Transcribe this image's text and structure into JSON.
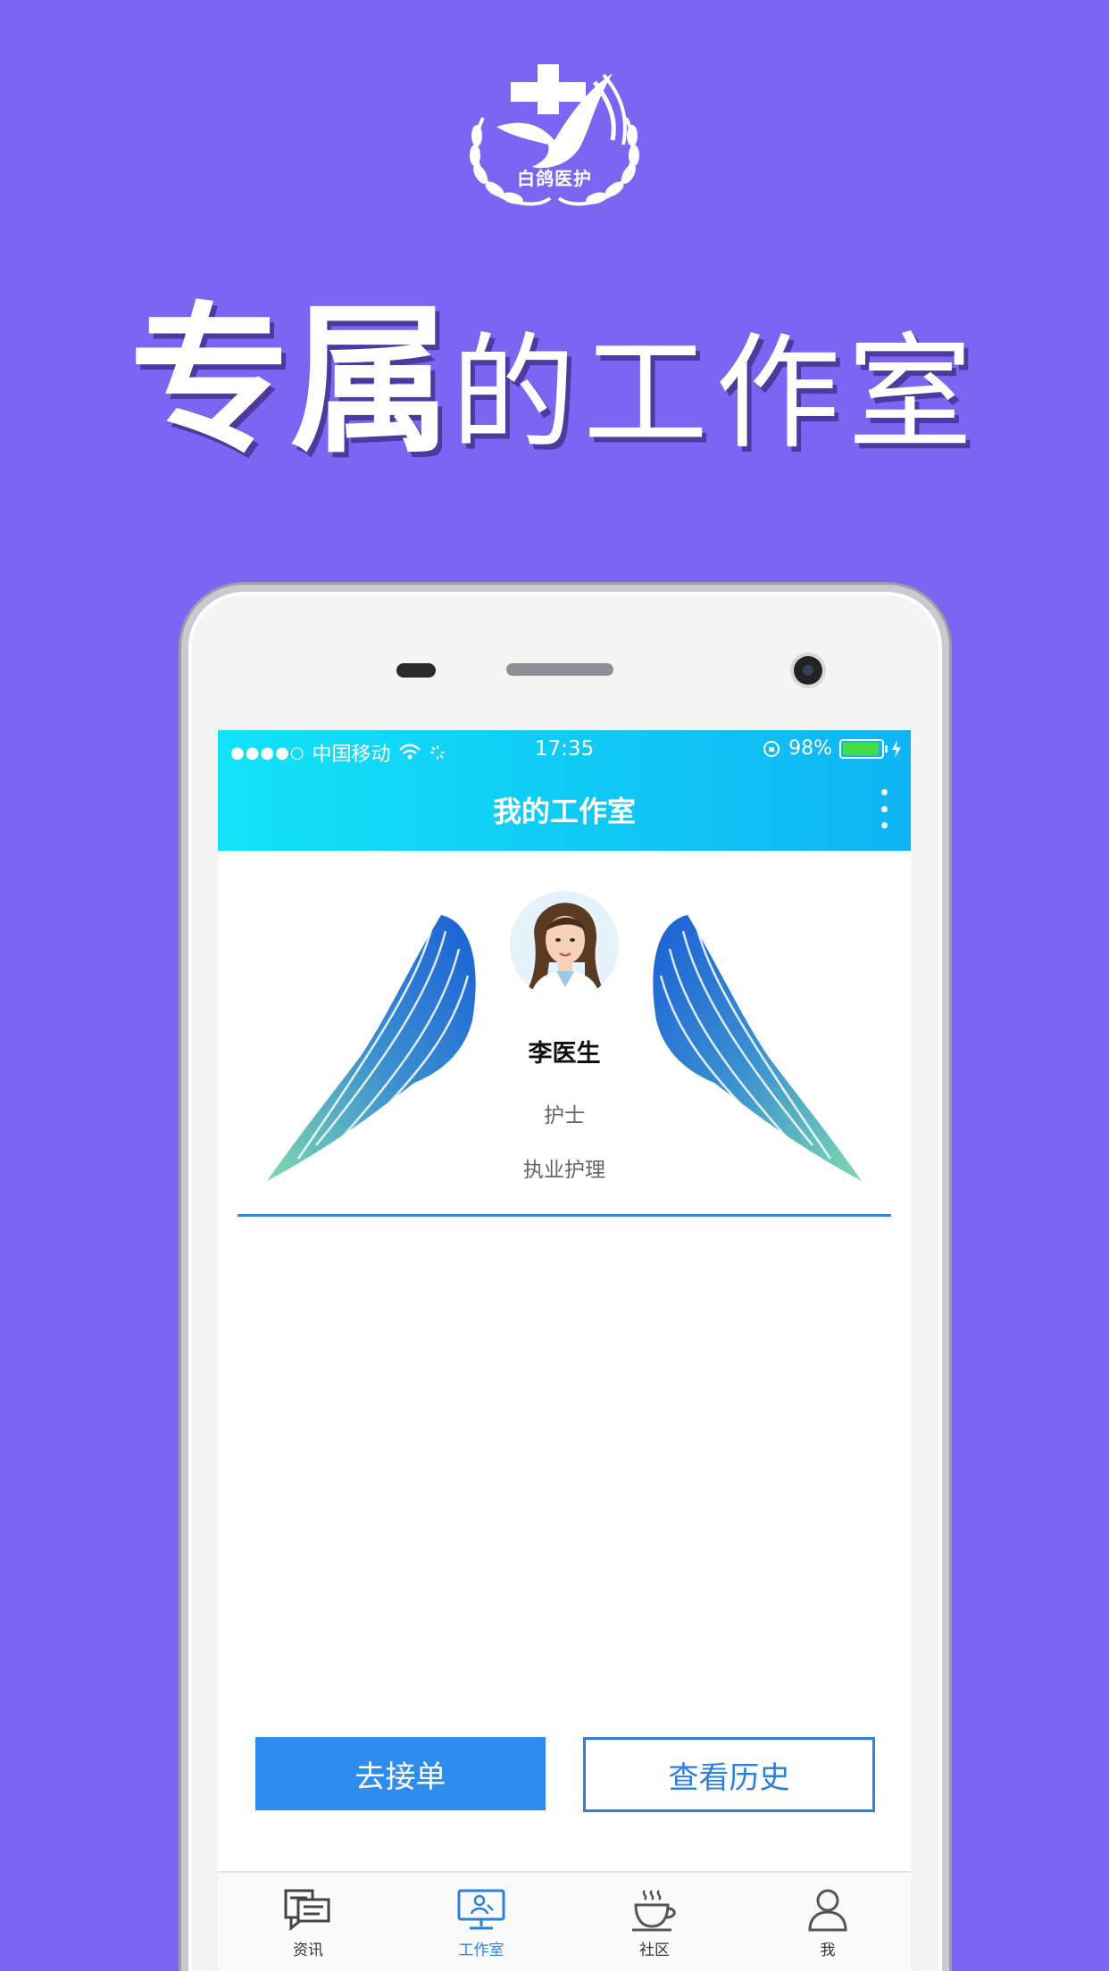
{
  "brand": {
    "logo_text": "白鸽医护"
  },
  "headline": {
    "part1": "专属",
    "part2": "的工作室"
  },
  "status_bar": {
    "signal_dots": "●●●●○",
    "carrier": "中国移动",
    "time": "17:35",
    "battery": "98%"
  },
  "nav": {
    "title": "我的工作室"
  },
  "profile": {
    "name": "李医生",
    "role": "护士",
    "service": "执业护理"
  },
  "actions": {
    "primary_label": "去接单",
    "secondary_label": "查看历史"
  },
  "tabs": [
    {
      "label": "资讯",
      "icon": "news-icon",
      "active": false
    },
    {
      "label": "工作室",
      "icon": "studio-icon",
      "active": true
    },
    {
      "label": "社区",
      "icon": "coffee-icon",
      "active": false
    },
    {
      "label": "我",
      "icon": "person-icon",
      "active": false
    }
  ],
  "colors": {
    "background": "#7B66F4",
    "topbar_gradient": [
      "#12e3f7",
      "#0fb4f4"
    ],
    "primary": "#2e8cef",
    "active_tab": "#2e80df"
  }
}
